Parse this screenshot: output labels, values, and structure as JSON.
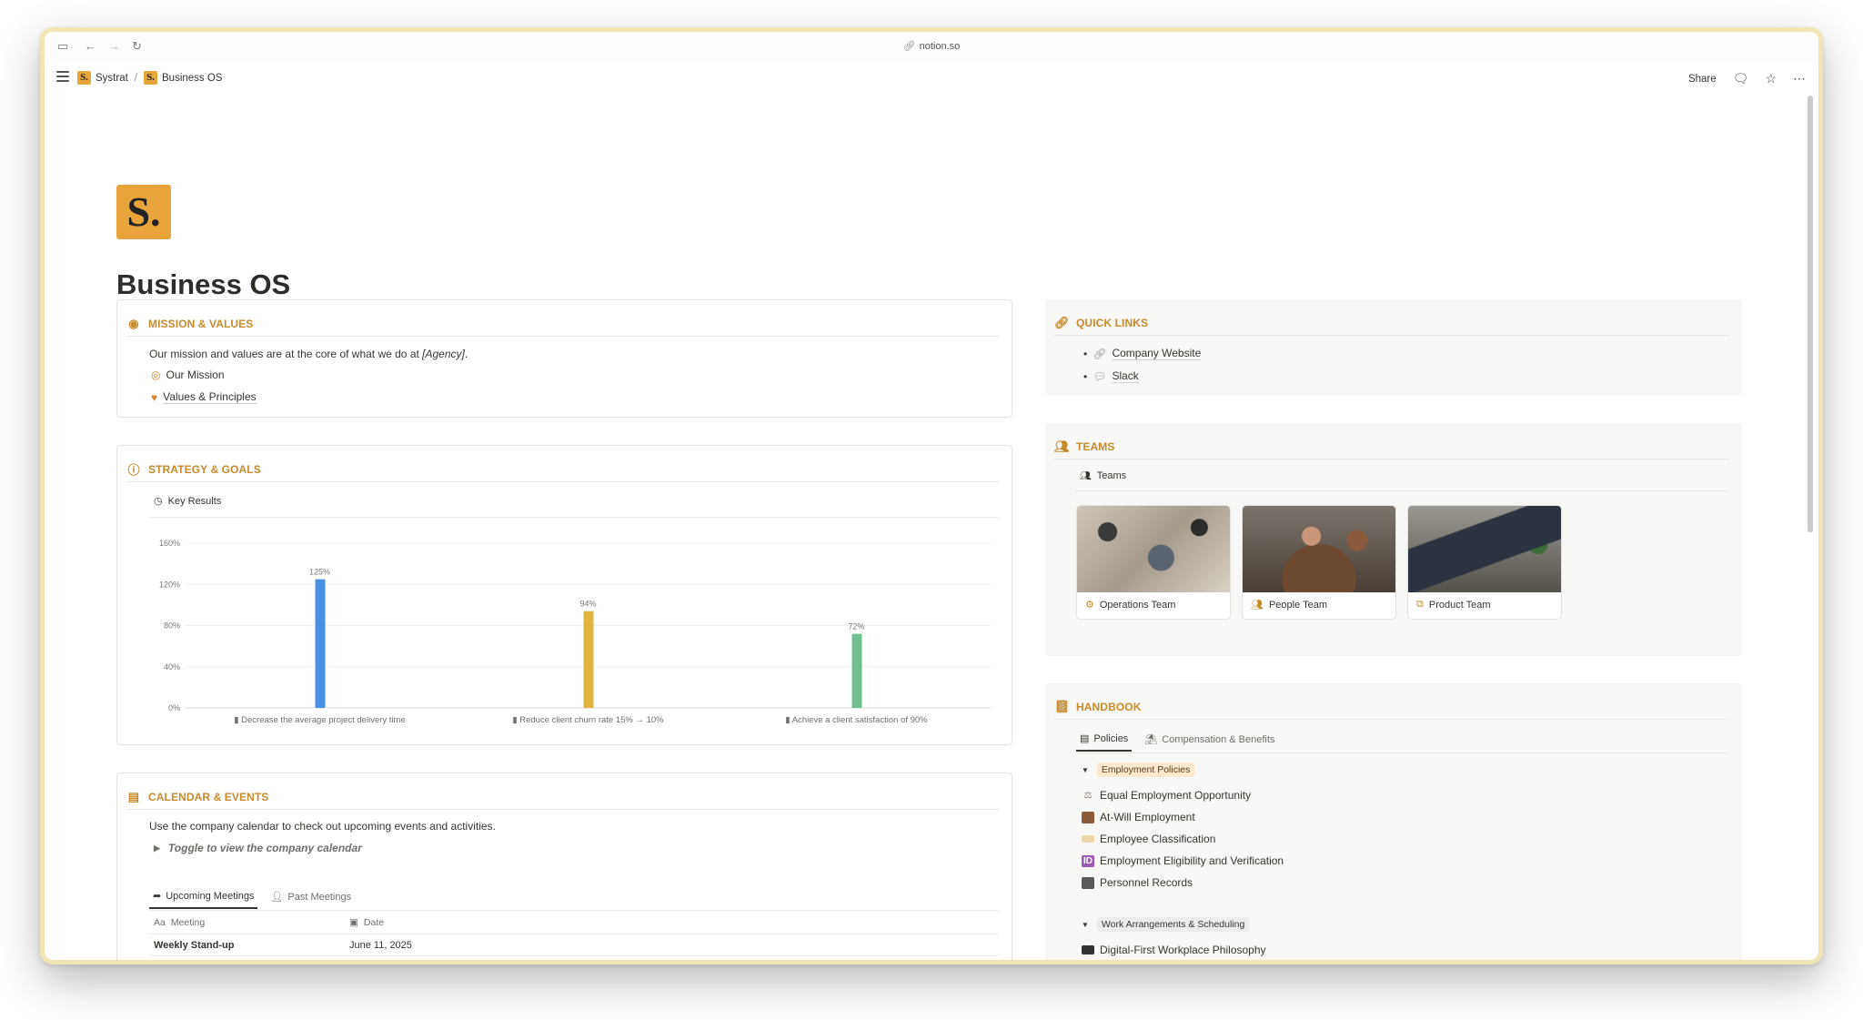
{
  "browser": {
    "url": "notion.so"
  },
  "breadcrumb": {
    "items": [
      "Systrat",
      "Business OS"
    ],
    "separator": "/"
  },
  "appbar": {
    "share_label": "Share"
  },
  "page": {
    "logo_letter": "S.",
    "title": "Business OS"
  },
  "mission": {
    "heading": "MISSION & VALUES",
    "text": "Our mission and values are at the core of what we do at",
    "text_em": "[Agency]",
    "text_end": ".",
    "links": [
      "Our Mission",
      "Values & Principles"
    ]
  },
  "strategy": {
    "heading": "STRATEGY & GOALS",
    "view_label": "Key Results"
  },
  "chart_data": {
    "type": "bar",
    "categories": [
      "Decrease the average project delivery time",
      "Reduce client churn rate 15% → 10%",
      "Achieve a client satisfaction of 90%"
    ],
    "values": [
      125,
      94,
      72
    ],
    "value_labels": [
      "125%",
      "94%",
      "72%"
    ],
    "colors": [
      "#4a90e2",
      "#e3b341",
      "#6fbf8f"
    ],
    "y_ticks": [
      "0%",
      "40%",
      "80%",
      "120%",
      "160%"
    ],
    "ylim": [
      0,
      160
    ],
    "grid": true,
    "xlabel": "",
    "ylabel": ""
  },
  "calendar": {
    "heading": "CALENDAR & EVENTS",
    "text": "Use the company calendar to check out upcoming events and activities.",
    "toggle_label": "Toggle to view the company calendar",
    "tabs": [
      "Upcoming Meetings",
      "Past Meetings"
    ],
    "columns": [
      "Meeting",
      "Date"
    ],
    "rows": [
      {
        "meeting": "Weekly Stand-up",
        "date": "June 11, 2025"
      }
    ]
  },
  "quick_links": {
    "heading": "QUICK LINKS",
    "items": [
      "Company Website",
      "Slack"
    ]
  },
  "teams": {
    "heading": "TEAMS",
    "view_label": "Teams",
    "cards": [
      "Operations Team",
      "People Team",
      "Product Team"
    ]
  },
  "handbook": {
    "heading": "HANDBOOK",
    "tabs": [
      "Policies",
      "Compensation & Benefits"
    ],
    "groups": [
      {
        "label": "Employment Policies",
        "items": [
          "Equal Employment Opportunity",
          "At-Will Employment",
          "Employee Classification",
          "Employment Eligibility and Verification",
          "Personnel Records"
        ]
      },
      {
        "label": "Work Arrangements & Scheduling",
        "items": [
          "Digital-First Workplace Philosophy"
        ]
      }
    ]
  },
  "colors": {
    "accent": "#c88a2a",
    "logo": "#e8a33b"
  }
}
